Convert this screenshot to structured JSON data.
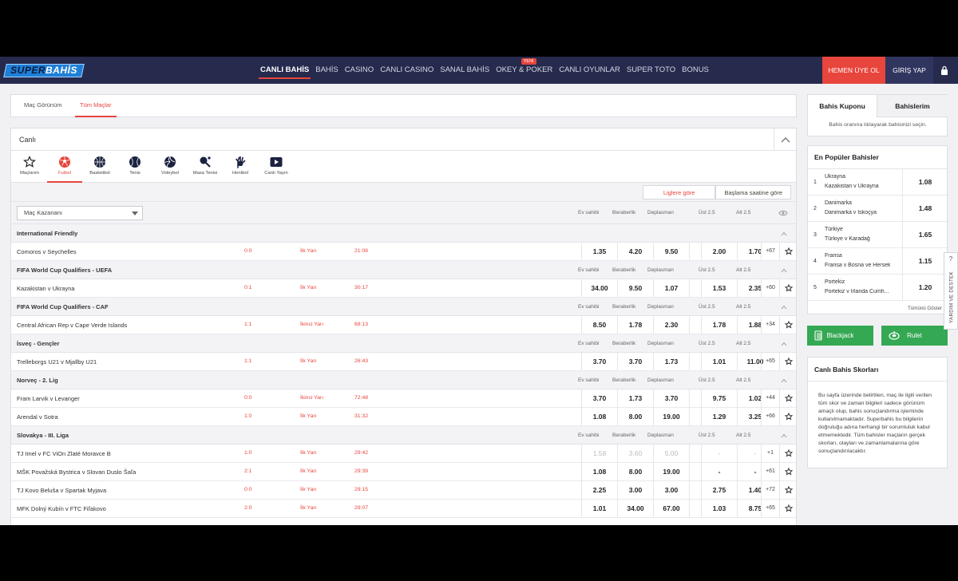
{
  "brand": {
    "part1": "SUPER",
    "part2": "BAHİS"
  },
  "nav": {
    "items": [
      "CANLI BAHİS",
      "BAHİS",
      "CASINO",
      "CANLI CASINO",
      "SANAL BAHİS",
      "OKEY & POKER",
      "CANLI OYUNLAR",
      "SUPER TOTO",
      "BONUS"
    ],
    "new_badge": "YENİ",
    "register": "HEMEN ÜYE OL",
    "login": "GİRİŞ YAP"
  },
  "view_tabs": [
    "Maç Görünüm",
    "Tüm Maçlar"
  ],
  "live": {
    "title": "Canlı",
    "sports": [
      "Maçlarım",
      "Futbol",
      "Basketbol",
      "Tenis",
      "Voleybol",
      "Masa Tenisi",
      "Hentbol",
      "Canlı Yayın"
    ],
    "sort": [
      "Liglere göre",
      "Başlama saatine göre"
    ],
    "market": "Maç Kazananı",
    "columns": [
      "Ev sahibi",
      "Beraberlik",
      "Deplasman",
      "Üst 2.5",
      "Alt 2.5"
    ]
  },
  "leagues": [
    {
      "name": "International Friendly",
      "matches": [
        {
          "name": "Comoros v Seychelles",
          "score": "0:0",
          "period": "İlk Yarı",
          "time": "21:06",
          "odds": [
            "1.35",
            "4.20",
            "9.50",
            "2.00",
            "1.70"
          ],
          "more": "+67"
        }
      ]
    },
    {
      "name": "FIFA World Cup Qualifiers - UEFA",
      "matches": [
        {
          "name": "Kazakistan v Ukrayna",
          "score": "0:1",
          "period": "İlk Yarı",
          "time": "30:17",
          "odds": [
            "34.00",
            "9.50",
            "1.07",
            "1.53",
            "2.35"
          ],
          "more": "+60"
        }
      ]
    },
    {
      "name": "FIFA World Cup Qualifiers - CAF",
      "matches": [
        {
          "name": "Central African Rep v Cape Verde Islands",
          "score": "1:1",
          "period": "İkinci Yarı",
          "time": "68:13",
          "odds": [
            "8.50",
            "1.78",
            "2.30",
            "1.78",
            "1.88"
          ],
          "more": "+34"
        }
      ]
    },
    {
      "name": "İsveç - Gençler",
      "matches": [
        {
          "name": "Trelleborgs U21 v Mjallby U21",
          "score": "1:1",
          "period": "İlk Yarı",
          "time": "26:43",
          "odds": [
            "3.70",
            "3.70",
            "1.73",
            "1.01",
            "11.00"
          ],
          "more": "+65"
        }
      ]
    },
    {
      "name": "Norveç - 2. Lig",
      "matches": [
        {
          "name": "Fram Larvik v Levanger",
          "score": "0:0",
          "period": "İkinci Yarı",
          "time": "72:48",
          "odds": [
            "3.70",
            "1.73",
            "3.70",
            "9.75",
            "1.02"
          ],
          "more": "+44"
        },
        {
          "name": "Arendal v Sotra",
          "score": "1:0",
          "period": "İlk Yarı",
          "time": "31:32",
          "odds": [
            "1.08",
            "8.00",
            "19.00",
            "1.29",
            "3.25"
          ],
          "more": "+66"
        }
      ]
    },
    {
      "name": "Slovakya - III. Liga",
      "matches": [
        {
          "name": "TJ Imel v FC ViOn Zlaté Moravce B",
          "score": "1:0",
          "period": "İlk Yarı",
          "time": "29:42",
          "odds": [
            "1.58",
            "3.60",
            "5.00",
            "-",
            "-"
          ],
          "more": "+1",
          "dim": true
        },
        {
          "name": "MŠK Považská Bystrica v Slovan Duslo Šaľa",
          "score": "2:1",
          "period": "İlk Yarı",
          "time": "29:39",
          "odds": [
            "1.08",
            "8.00",
            "19.00",
            "-",
            "-"
          ],
          "more": "+61"
        },
        {
          "name": "TJ Kovo Beluša v Spartak Myjava",
          "score": "0:0",
          "period": "İlk Yarı",
          "time": "29:15",
          "odds": [
            "2.25",
            "3.00",
            "3.00",
            "2.75",
            "1.40"
          ],
          "more": "+72"
        },
        {
          "name": "MFK Dolný Kubín v FTC Fiľakovo",
          "score": "2:0",
          "period": "İlk Yarı",
          "time": "29:07",
          "odds": [
            "1.01",
            "34.00",
            "67.00",
            "1.03",
            "8.75"
          ],
          "more": "+65"
        }
      ]
    }
  ],
  "coupon": {
    "tab1": "Bahis Kuponu",
    "tab2": "Bahislerim",
    "hint": "Bahis oranına tıklayarak bahisinizi seçin."
  },
  "popular": {
    "title": "En Popüler Bahisler",
    "items": [
      {
        "n": "1",
        "choice": "Ukrayna",
        "match": "Kazakistan v Ukrayna",
        "odd": "1.08"
      },
      {
        "n": "2",
        "choice": "Danimarka",
        "match": "Danimarka v İskoçya",
        "odd": "1.48"
      },
      {
        "n": "3",
        "choice": "Türkiye",
        "match": "Türkiye v Karadağ",
        "odd": "1.65"
      },
      {
        "n": "4",
        "choice": "Fransa",
        "match": "Fransa v Bosna ve Hersek",
        "odd": "1.15"
      },
      {
        "n": "5",
        "choice": "Portekiz",
        "match": "Portekiz v İrlanda Cumh...",
        "odd": "1.20"
      }
    ],
    "show_all": "Tümünü Göster"
  },
  "games": {
    "blackjack": "Blackjack",
    "roulette": "Rulet"
  },
  "scores": {
    "title": "Canlı Bahis Skorları",
    "text": "Bu sayfa üzerinde belirtilen, maç ile ilgili verilen tüm skor ve zaman bilgileri sadece görünüm amaçlı olup, bahis sonuçlandırma işleminde kullanılmamaktadır. Superbahis bu bilgilerin doğruluğu adına herhangi bir sorumluluk kabul etmemektedir. Tüm bahisler maçların gerçek skorları, olayları ve zamanlamalarına göre sonuçlandırılacaktır."
  },
  "help": {
    "q": "?",
    "label": "YARDIM VE DESTEK"
  },
  "colors": {
    "nav_bg": "#262a4d",
    "accent": "#e8453c",
    "green": "#35a853"
  }
}
